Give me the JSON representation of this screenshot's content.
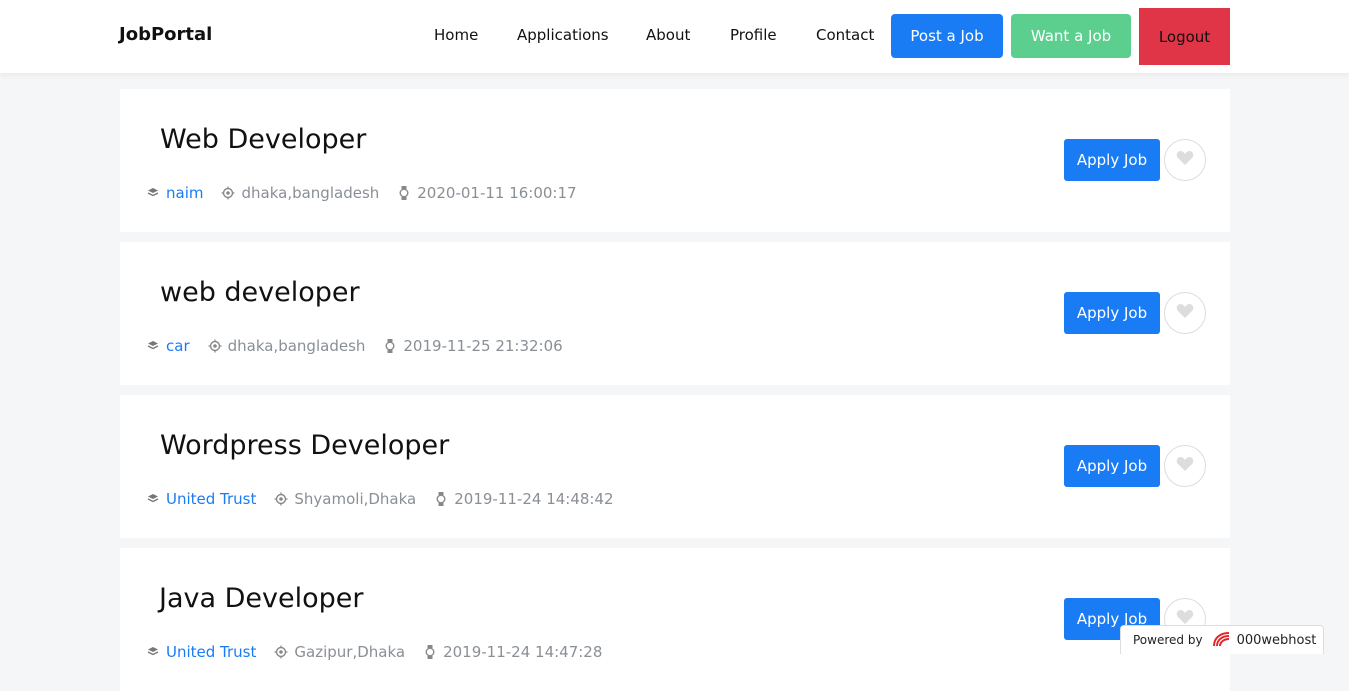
{
  "brand": "JobPortal",
  "nav": {
    "home": "Home",
    "applications": "Applications",
    "about": "About",
    "profile": "Profile",
    "contact": "Contact",
    "post_job": "Post a Job",
    "want_job": "Want a Job",
    "logout": "Logout"
  },
  "jobs": [
    {
      "title": "Web Developer",
      "company": "naim",
      "location": "dhaka,bangladesh",
      "posted": "2020-01-11 16:00:17",
      "apply": "Apply Job"
    },
    {
      "title": "web developer",
      "company": "car",
      "location": "dhaka,bangladesh",
      "posted": "2019-11-25 21:32:06",
      "apply": "Apply Job"
    },
    {
      "title": "Wordpress Developer",
      "company": "United Trust",
      "location": "Shyamoli,Dhaka",
      "posted": "2019-11-24 14:48:42",
      "apply": "Apply Job"
    },
    {
      "title": "Java Developer",
      "company": "United Trust",
      "location": "Gazipur,Dhaka",
      "posted": "2019-11-24 14:47:28",
      "apply": "Apply Job"
    }
  ],
  "footer_badge": {
    "prefix": "Powered by",
    "brand": "000webhost"
  },
  "colors": {
    "primary": "#1a7cf5",
    "success": "#5ccf8f",
    "danger": "#df3547"
  }
}
